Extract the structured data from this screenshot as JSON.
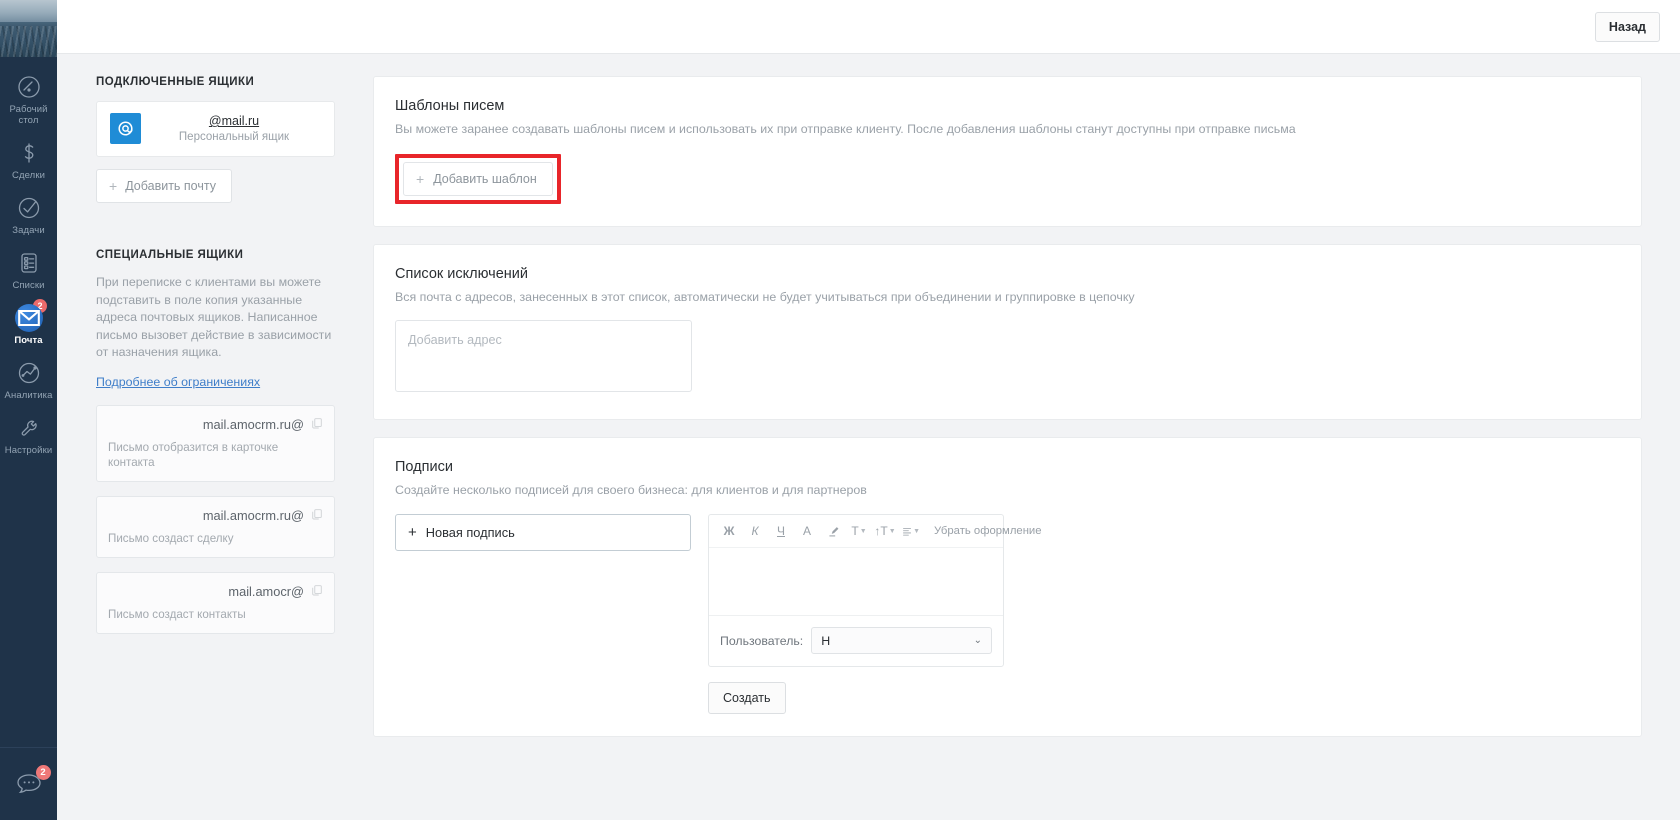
{
  "topbar": {
    "back_label": "Назад"
  },
  "sidebar": {
    "items": [
      {
        "label": "Рабочий стол",
        "icon": "dashboard-icon",
        "badge": ""
      },
      {
        "label": "Сделки",
        "icon": "deals-icon",
        "badge": ""
      },
      {
        "label": "Задачи",
        "icon": "tasks-icon",
        "badge": ""
      },
      {
        "label": "Списки",
        "icon": "lists-icon",
        "badge": ""
      },
      {
        "label": "Почта",
        "icon": "mail-icon",
        "badge": "2"
      },
      {
        "label": "Аналитика",
        "icon": "analytics-icon",
        "badge": ""
      },
      {
        "label": "Настройки",
        "icon": "settings-icon",
        "badge": ""
      }
    ],
    "chat": {
      "icon": "chat-bubble-icon",
      "badge": "2"
    }
  },
  "left_column": {
    "connected_title": "ПОДКЛЮЧЕННЫЕ ЯЩИКИ",
    "connected_mailbox": {
      "address": "@mail.ru",
      "subtitle": "Персональный ящик",
      "logo": "mailru-logo-icon"
    },
    "add_mail_label": "Добавить почту",
    "special_title": "СПЕЦИАЛЬНЫЕ ЯЩИКИ",
    "special_desc": "При переписке с клиентами вы можете подставить в поле копия указанные адреса почтовых ящиков. Написанное письмо вызовет действие в зависимости от назначения ящика.",
    "special_link": "Подробнее об ограничениях",
    "special_cards": [
      {
        "address": "@mail.amocrm.ru",
        "note": "Письмо отобразится в карточке контакта"
      },
      {
        "address": "@mail.amocrm.ru",
        "note": "Письмо создаст сделку"
      },
      {
        "address": "@mail.amocr",
        "note": "Письмо создаст контакты"
      }
    ]
  },
  "templates_panel": {
    "title": "Шаблоны писем",
    "desc": "Вы можете заранее создавать шаблоны писем и использовать их при отправке клиенту. После добавления шаблоны станут доступны при отправке письма",
    "add_button_label": "Добавить шаблон",
    "highlight_color": "#e8252a"
  },
  "exclusions_panel": {
    "title": "Список исключений",
    "desc": "Вся почта с адресов, занесенных в этот список, автоматически не будет учитываться при объединении и группировке в цепочку",
    "input_value": "",
    "input_placeholder": "Добавить адрес"
  },
  "signatures_panel": {
    "title": "Подписи",
    "desc": "Создайте несколько подписей для своего бизнеса: для клиентов и для партнеров",
    "new_signature_label": "Новая подпись",
    "toolbar": {
      "bold": "Ж",
      "italic": "К",
      "underline": "Ч",
      "font_color": "A",
      "highlight": "highlighter-icon",
      "font_family": "T",
      "font_size": "↑T",
      "align": "align-left-icon",
      "clear_format": "Убрать оформление"
    },
    "editor_content": "",
    "user_label": "Пользователь:",
    "user_value": "Н",
    "create_button_label": "Создать"
  }
}
